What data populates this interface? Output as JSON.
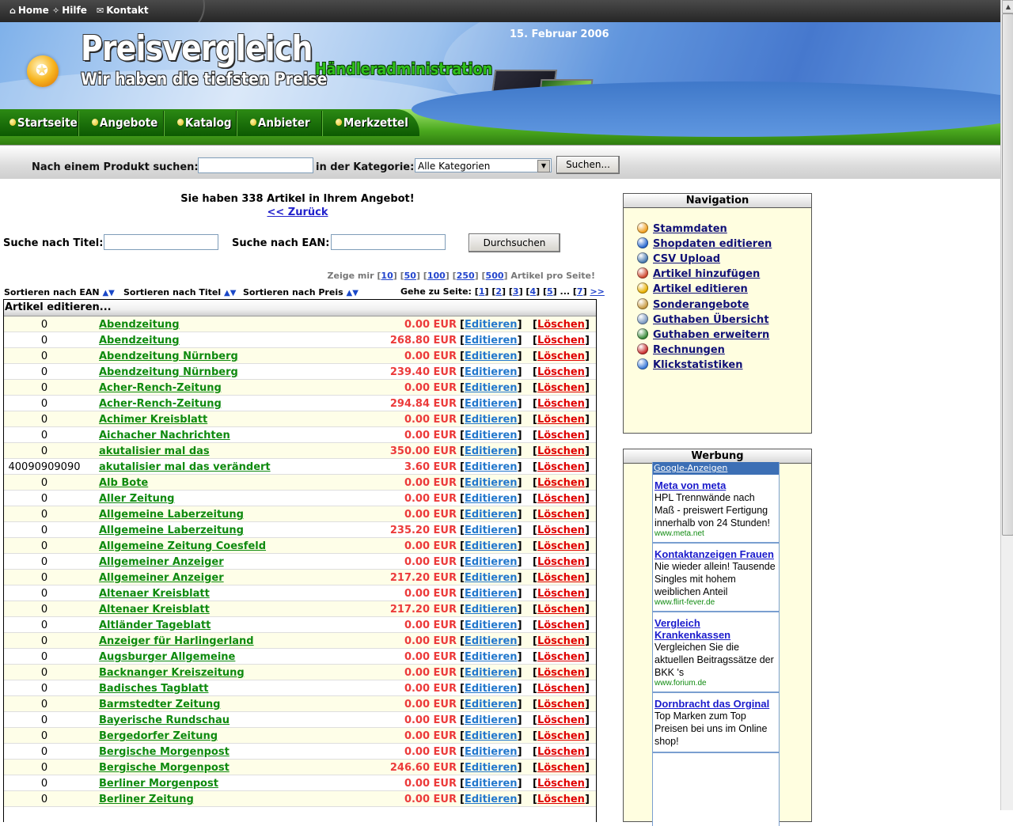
{
  "topbar": {
    "home": "Home",
    "help": "Hilfe",
    "contact": "Kontakt"
  },
  "header": {
    "title": "Preisvergleich",
    "slogan": "Wir haben die tiefsten Preise",
    "subtitle": "Händleradministration",
    "date": "15. Februar 2006"
  },
  "mainnav": [
    "Startseite",
    "Angebote",
    "Katalog",
    "Anbieter",
    "Merkzettel"
  ],
  "search": {
    "label": "Nach einem Produkt suchen:",
    "category_label": "in der Kategorie:",
    "category_value": "Alle Kategorien",
    "button": "Suchen..."
  },
  "content": {
    "count_text": "Sie haben 338 Artikel in Ihrem Angebot!",
    "back": "<< Zurück",
    "search_title_label": "Suche nach Titel:",
    "search_ean_label": "Suche nach EAN:",
    "search_button": "Durchsuchen",
    "perpage_prefix": "Zeige mir",
    "perpage_options": [
      "10",
      "50",
      "100",
      "250",
      "500"
    ],
    "perpage_suffix": "Artikel pro Seite!",
    "sort_ean": "Sortieren nach EAN",
    "sort_title": "Sortieren nach Titel",
    "sort_price": "Sortieren nach Preis",
    "goto_label": "Gehe zu Seite:",
    "goto_pages": [
      "1",
      "2",
      "3",
      "4",
      "5"
    ],
    "goto_ellipsis": "...",
    "goto_last": "7",
    "goto_next": ">>",
    "table_title": "Artikel editieren...",
    "edit_label": "Editieren",
    "delete_label": "Löschen"
  },
  "articles": [
    {
      "ean": "0",
      "title": "Abendzeitung",
      "price": "0.00 EUR"
    },
    {
      "ean": "0",
      "title": "Abendzeitung",
      "price": "268.80 EUR"
    },
    {
      "ean": "0",
      "title": "Abendzeitung Nürnberg",
      "price": "0.00 EUR"
    },
    {
      "ean": "0",
      "title": "Abendzeitung Nürnberg",
      "price": "239.40 EUR"
    },
    {
      "ean": "0",
      "title": "Acher-Rench-Zeitung",
      "price": "0.00 EUR"
    },
    {
      "ean": "0",
      "title": "Acher-Rench-Zeitung",
      "price": "294.84 EUR"
    },
    {
      "ean": "0",
      "title": "Achimer Kreisblatt",
      "price": "0.00 EUR"
    },
    {
      "ean": "0",
      "title": "Aichacher Nachrichten",
      "price": "0.00 EUR"
    },
    {
      "ean": "0",
      "title": "akutalisier mal das",
      "price": "350.00 EUR"
    },
    {
      "ean": "40090909090",
      "title": "akutalisier mal das verändert",
      "price": "3.60 EUR"
    },
    {
      "ean": "0",
      "title": "Alb Bote",
      "price": "0.00 EUR"
    },
    {
      "ean": "0",
      "title": "Aller Zeitung",
      "price": "0.00 EUR"
    },
    {
      "ean": "0",
      "title": "Allgemeine Laberzeitung",
      "price": "0.00 EUR"
    },
    {
      "ean": "0",
      "title": "Allgemeine Laberzeitung",
      "price": "235.20 EUR"
    },
    {
      "ean": "0",
      "title": "Allgemeine Zeitung Coesfeld",
      "price": "0.00 EUR"
    },
    {
      "ean": "0",
      "title": "Allgemeiner Anzeiger",
      "price": "0.00 EUR"
    },
    {
      "ean": "0",
      "title": "Allgemeiner Anzeiger",
      "price": "217.20 EUR"
    },
    {
      "ean": "0",
      "title": "Altenaer Kreisblatt",
      "price": "0.00 EUR"
    },
    {
      "ean": "0",
      "title": "Altenaer Kreisblatt",
      "price": "217.20 EUR"
    },
    {
      "ean": "0",
      "title": "Altländer Tageblatt",
      "price": "0.00 EUR"
    },
    {
      "ean": "0",
      "title": "Anzeiger für Harlingerland",
      "price": "0.00 EUR"
    },
    {
      "ean": "0",
      "title": "Augsburger Allgemeine",
      "price": "0.00 EUR"
    },
    {
      "ean": "0",
      "title": "Backnanger Kreiszeitung",
      "price": "0.00 EUR"
    },
    {
      "ean": "0",
      "title": "Badisches Tagblatt",
      "price": "0.00 EUR"
    },
    {
      "ean": "0",
      "title": "Barmstedter Zeitung",
      "price": "0.00 EUR"
    },
    {
      "ean": "0",
      "title": "Bayerische Rundschau",
      "price": "0.00 EUR"
    },
    {
      "ean": "0",
      "title": "Bergedorfer Zeitung",
      "price": "0.00 EUR"
    },
    {
      "ean": "0",
      "title": "Bergische Morgenpost",
      "price": "0.00 EUR"
    },
    {
      "ean": "0",
      "title": "Bergische Morgenpost",
      "price": "246.60 EUR"
    },
    {
      "ean": "0",
      "title": "Berliner Morgenpost",
      "price": "0.00 EUR"
    },
    {
      "ean": "0",
      "title": "Berliner Zeitung",
      "price": "0.00 EUR"
    }
  ],
  "sidebar": {
    "nav_title": "Navigation",
    "nav_items": [
      {
        "label": "Stammdaten",
        "icon": "home-icon",
        "color": "#f0a020"
      },
      {
        "label": "Shopdaten editieren",
        "icon": "shop-icon",
        "color": "#2a6ad0"
      },
      {
        "label": "CSV Upload",
        "icon": "monitor-icon",
        "color": "#4a7ab0"
      },
      {
        "label": "Artikel hinzufügen",
        "icon": "add-icon",
        "color": "#d04a30"
      },
      {
        "label": "Artikel editieren",
        "icon": "edit-icon",
        "color": "#e8b000"
      },
      {
        "label": "Sonderangebote",
        "icon": "tag-icon",
        "color": "#c89a40"
      },
      {
        "label": "Guthaben Übersicht",
        "icon": "document-icon",
        "color": "#7a98c0"
      },
      {
        "label": "Guthaben erweitern",
        "icon": "coin-icon",
        "color": "#3a8a3a"
      },
      {
        "label": "Rechnungen",
        "icon": "toolbox-icon",
        "color": "#c83030"
      },
      {
        "label": "Klickstatistiken",
        "icon": "help-icon",
        "color": "#3a7ad8"
      }
    ],
    "ads_title": "Werbung",
    "ads_header": "Google-Anzeigen",
    "ads": [
      {
        "title": "Meta von meta",
        "body": "HPL Trennwände nach Maß - preiswert Fertigung innerhalb von 24 Stunden!",
        "url": "www.meta.net"
      },
      {
        "title": "Kontaktanzeigen Frauen",
        "body": "Nie wieder allein! Tausende Singles mit hohem weiblichen Anteil",
        "url": "www.flirt-fever.de"
      },
      {
        "title": "Vergleich Krankenkassen",
        "body": "Vergleichen Sie die aktuellen Beitragssätze der BKK 's",
        "url": "www.forium.de"
      },
      {
        "title": "Dornbracht das Orginal",
        "body": "Top Marken zum Top Preisen bei uns im Online shop!",
        "url": ""
      }
    ]
  }
}
